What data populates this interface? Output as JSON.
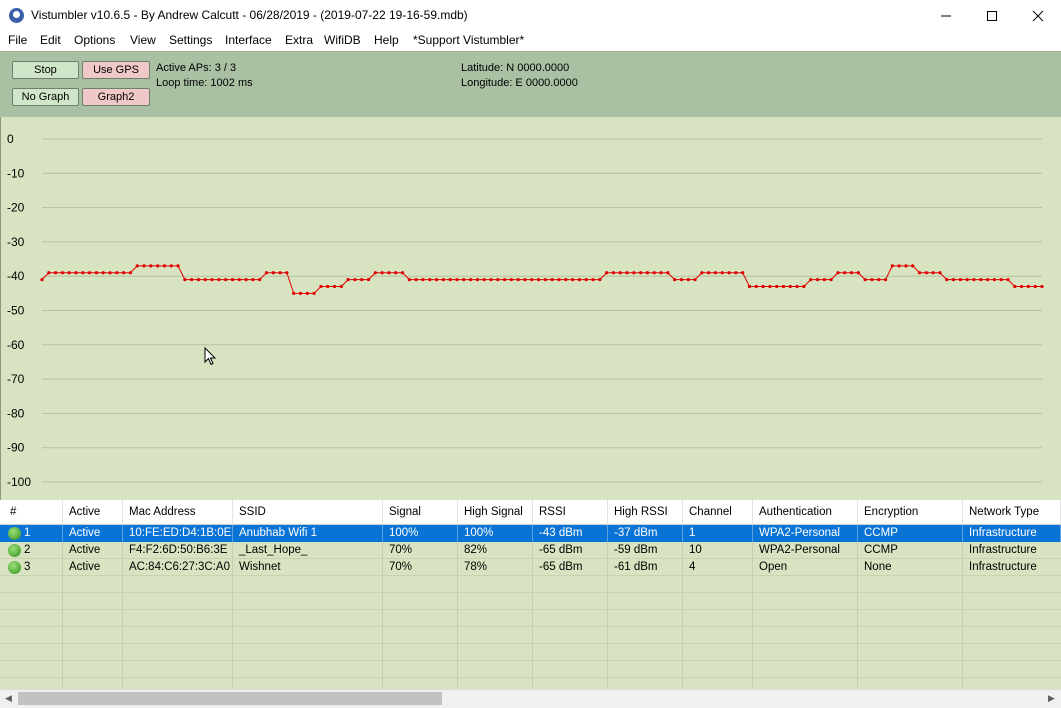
{
  "window": {
    "title": "Vistumbler v10.6.5 - By Andrew Calcutt - 06/28/2019 - (2019-07-22 19-16-59.mdb)",
    "minimize_icon": "minimize-icon",
    "maximize_icon": "maximize-icon",
    "close_icon": "close-icon"
  },
  "menu": [
    "File",
    "Edit",
    "Options",
    "View",
    "Settings",
    "Interface",
    "Extra",
    "WifiDB",
    "Help",
    "*Support Vistumbler*"
  ],
  "toolbar": {
    "stop_label": "Stop",
    "use_gps_label": "Use GPS",
    "no_graph_label": "No Graph",
    "graph2_label": "Graph2",
    "active_aps": "Active APs: 3 / 3",
    "loop_time": "Loop time: 1002 ms",
    "latitude": "Latitude: N 0000.0000",
    "longitude": "Longitude: E 0000.0000"
  },
  "colors": {
    "graph_background": "#d8e4c1",
    "signal_line": "#e00000",
    "toolbar_background": "#a9c0a3",
    "selected_row": "#0a74d6"
  },
  "chart_data": {
    "type": "line",
    "ylim": [
      -100,
      0
    ],
    "y_ticks": [
      "0",
      "-10",
      "-20",
      "-30",
      "-40",
      "-50",
      "-60",
      "-70",
      "-80",
      "-90",
      "-100"
    ],
    "grid": true,
    "series": [
      {
        "values": [
          -41,
          -39,
          -39,
          -39,
          -39,
          -39,
          -39,
          -39,
          -39,
          -39,
          -39,
          -39,
          -39,
          -39,
          -37,
          -37,
          -37,
          -37,
          -37,
          -37,
          -37,
          -41,
          -41,
          -41,
          -41,
          -41,
          -41,
          -41,
          -41,
          -41,
          -41,
          -41,
          -41,
          -39,
          -39,
          -39,
          -39,
          -45,
          -45,
          -45,
          -45,
          -43,
          -43,
          -43,
          -43,
          -41,
          -41,
          -41,
          -41,
          -39,
          -39,
          -39,
          -39,
          -39,
          -41,
          -41,
          -41,
          -41,
          -41,
          -41,
          -41,
          -41,
          -41,
          -41,
          -41,
          -41,
          -41,
          -41,
          -41,
          -41,
          -41,
          -41,
          -41,
          -41,
          -41,
          -41,
          -41,
          -41,
          -41,
          -41,
          -41,
          -41,
          -41,
          -39,
          -39,
          -39,
          -39,
          -39,
          -39,
          -39,
          -39,
          -39,
          -39,
          -41,
          -41,
          -41,
          -41,
          -39,
          -39,
          -39,
          -39,
          -39,
          -39,
          -39,
          -43,
          -43,
          -43,
          -43,
          -43,
          -43,
          -43,
          -43,
          -43,
          -41,
          -41,
          -41,
          -41,
          -39,
          -39,
          -39,
          -39,
          -41,
          -41,
          -41,
          -41,
          -37,
          -37,
          -37,
          -37,
          -39,
          -39,
          -39,
          -39,
          -41,
          -41,
          -41,
          -41,
          -41,
          -41,
          -41,
          -41,
          -41,
          -41,
          -43,
          -43,
          -43,
          -43,
          -43
        ]
      }
    ]
  },
  "table": {
    "columns": [
      "#",
      "Active",
      "Mac Address",
      "SSID",
      "Signal",
      "High Signal",
      "RSSI",
      "High RSSI",
      "Channel",
      "Authentication",
      "Encryption",
      "Network Type"
    ],
    "rows": [
      {
        "num": "1",
        "icon": "signal-wifi-icon",
        "active": "Active",
        "mac": "10:FE:ED:D4:1B:0E",
        "ssid": "Anubhab Wifi 1",
        "signal": "100%",
        "high_signal": "100%",
        "rssi": "-43 dBm",
        "high_rssi": "-37 dBm",
        "channel": "1",
        "auth": "WPA2-Personal",
        "enc": "CCMP",
        "net_type": "Infrastructure"
      },
      {
        "num": "2",
        "icon": "lock-wifi-icon",
        "active": "Active",
        "mac": "F4:F2:6D:50:B6:3E",
        "ssid": "_Last_Hope_",
        "signal": "70%",
        "high_signal": "82%",
        "rssi": "-65 dBm",
        "high_rssi": "-59 dBm",
        "channel": "10",
        "auth": "WPA2-Personal",
        "enc": "CCMP",
        "net_type": "Infrastructure"
      },
      {
        "num": "3",
        "icon": "open-wifi-icon",
        "active": "Active",
        "mac": "AC:84:C6:27:3C:A0",
        "ssid": "Wishnet",
        "signal": "70%",
        "high_signal": "78%",
        "rssi": "-65 dBm",
        "high_rssi": "-61 dBm",
        "channel": "4",
        "auth": "Open",
        "enc": "None",
        "net_type": "Infrastructure"
      }
    ]
  }
}
